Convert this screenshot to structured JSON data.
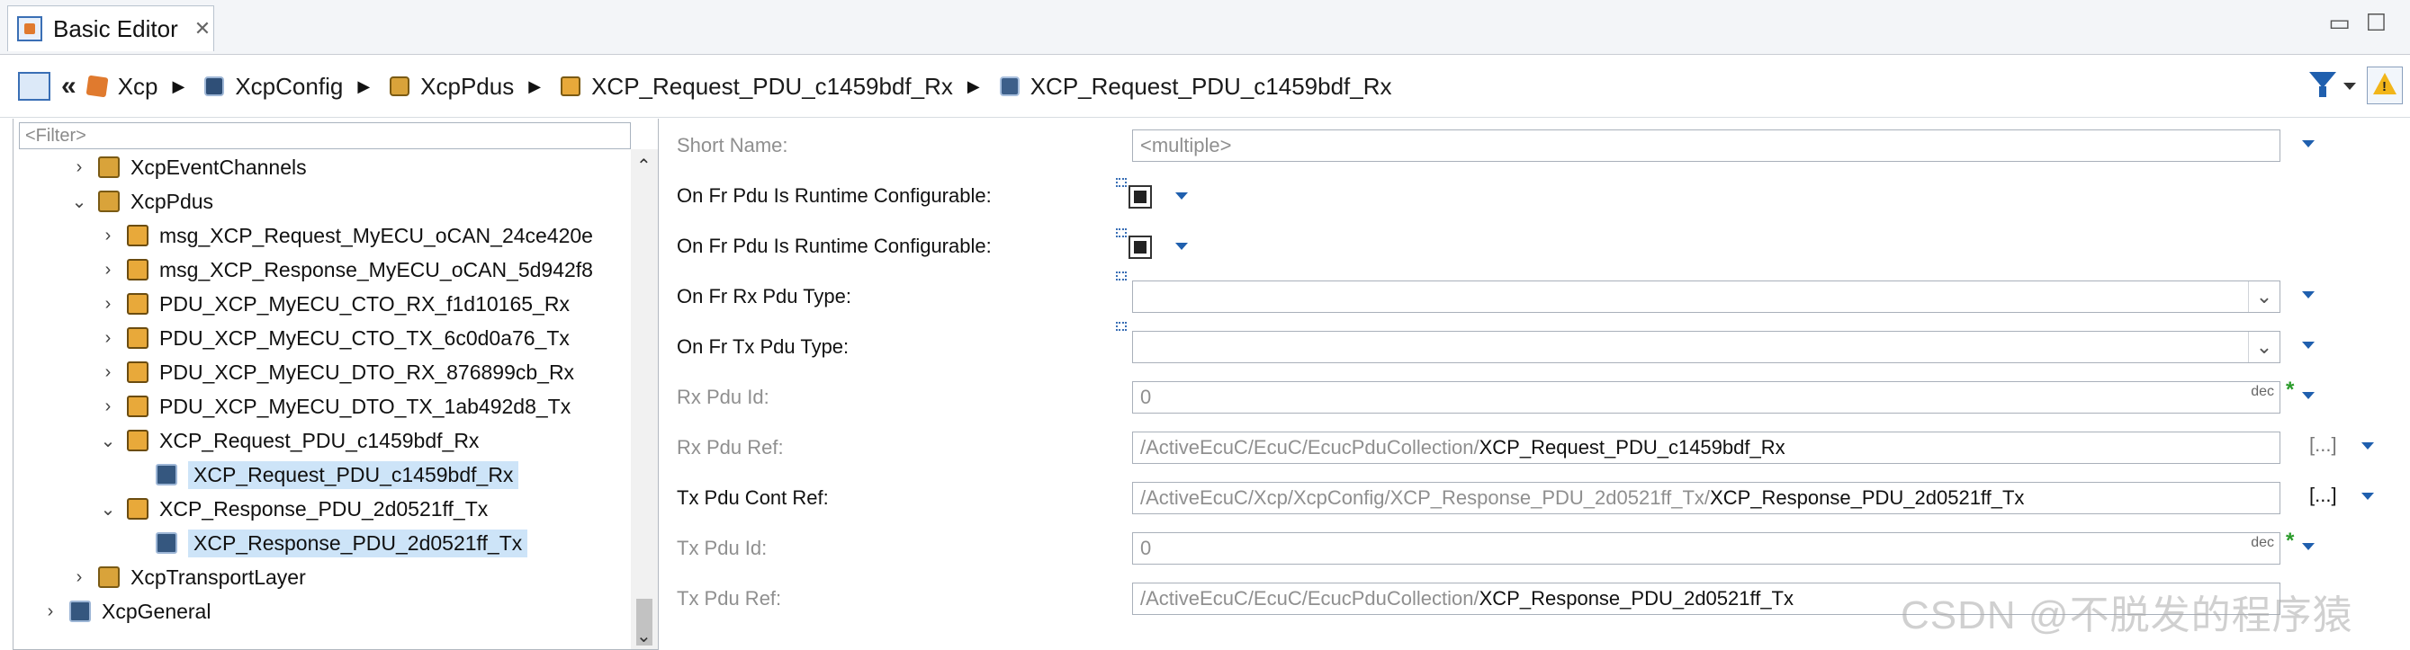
{
  "editor_tab": {
    "title": "Basic Editor",
    "close_glyph": "✕",
    "minimize_glyph": "▭",
    "maximize_glyph": "☐"
  },
  "toolbar": {
    "back_glyph": "«",
    "breadcrumbs": [
      {
        "label": "Xcp",
        "icon": "xcp-module-icon"
      },
      {
        "label": "XcpConfig",
        "icon": "container-icon"
      },
      {
        "label": "XcpPdus",
        "icon": "folder-icon"
      },
      {
        "label": "XCP_Request_PDU_c1459bdf_Rx",
        "icon": "pdu-icon"
      },
      {
        "label": "XCP_Request_PDU_c1459bdf_Rx",
        "icon": "instance-icon"
      }
    ]
  },
  "tree": {
    "filter_placeholder": "<Filter>",
    "items": [
      {
        "label": "XcpEventChannels",
        "twist": "›",
        "icon": "folder",
        "indent": 1
      },
      {
        "label": "XcpPdus",
        "twist": "⌄",
        "icon": "folder",
        "indent": 1
      },
      {
        "label": "msg_XCP_Request_MyECU_oCAN_24ce420e",
        "twist": "›",
        "icon": "pdu",
        "indent": 2
      },
      {
        "label": "msg_XCP_Response_MyECU_oCAN_5d942f8",
        "twist": "›",
        "icon": "pdu",
        "indent": 2
      },
      {
        "label": "PDU_XCP_MyECU_CTO_RX_f1d10165_Rx",
        "twist": "›",
        "icon": "pdu",
        "indent": 2
      },
      {
        "label": "PDU_XCP_MyECU_CTO_TX_6c0d0a76_Tx",
        "twist": "›",
        "icon": "pdu",
        "indent": 2
      },
      {
        "label": "PDU_XCP_MyECU_DTO_RX_876899cb_Rx",
        "twist": "›",
        "icon": "pdu",
        "indent": 2
      },
      {
        "label": "PDU_XCP_MyECU_DTO_TX_1ab492d8_Tx",
        "twist": "›",
        "icon": "pdu",
        "indent": 2
      },
      {
        "label": "XCP_Request_PDU_c1459bdf_Rx",
        "twist": "⌄",
        "icon": "pdu",
        "indent": 2
      },
      {
        "label": "XCP_Request_PDU_c1459bdf_Rx",
        "twist": "",
        "icon": "inst",
        "indent": 3,
        "selected": true
      },
      {
        "label": "XCP_Response_PDU_2d0521ff_Tx",
        "twist": "⌄",
        "icon": "pdu",
        "indent": 2
      },
      {
        "label": "XCP_Response_PDU_2d0521ff_Tx",
        "twist": "",
        "icon": "inst",
        "indent": 3,
        "selected": true
      },
      {
        "label": "XcpTransportLayer",
        "twist": "›",
        "icon": "folder",
        "indent": 1
      },
      {
        "label": "XcpGeneral",
        "twist": "›",
        "icon": "inst",
        "indent": 0
      }
    ]
  },
  "form": {
    "short_name": {
      "label": "Short Name:",
      "value": "<multiple>"
    },
    "fr_runtime_1": {
      "label": "On Fr Pdu Is Runtime Configurable:"
    },
    "fr_runtime_2": {
      "label": "On Fr Pdu Is Runtime Configurable:"
    },
    "fr_rx_type": {
      "label": "On Fr Rx Pdu Type:",
      "value": ""
    },
    "fr_tx_type": {
      "label": "On Fr Tx Pdu Type:",
      "value": ""
    },
    "rx_pdu_id": {
      "label": "Rx Pdu Id:",
      "value": "0",
      "unit": "dec",
      "asterisk": "*"
    },
    "rx_pdu_ref": {
      "label": "Rx Pdu Ref:",
      "prefix": "/ActiveEcuC/EcuC/EcucPduCollection/",
      "name": "XCP_Request_PDU_c1459bdf_Rx",
      "ellipsis": "[...]"
    },
    "tx_pdu_cont_ref": {
      "label": "Tx Pdu Cont Ref:",
      "prefix": "/ActiveEcuC/Xcp/XcpConfig/XCP_Response_PDU_2d0521ff_Tx/",
      "name": "XCP_Response_PDU_2d0521ff_Tx",
      "ellipsis": "[...]"
    },
    "tx_pdu_id": {
      "label": "Tx Pdu Id:",
      "value": "0",
      "unit": "dec",
      "asterisk": "*"
    },
    "tx_pdu_ref": {
      "label": "Tx Pdu Ref:",
      "prefix": "/ActiveEcuC/EcuC/EcucPduCollection/",
      "name": "XCP_Response_PDU_2d0521ff_Tx"
    }
  },
  "watermark": "CSDN @不脱发的程序猿",
  "colors": {
    "accent": "#1f5fae",
    "selection": "#cde4f8",
    "warning": "#f2b519"
  }
}
